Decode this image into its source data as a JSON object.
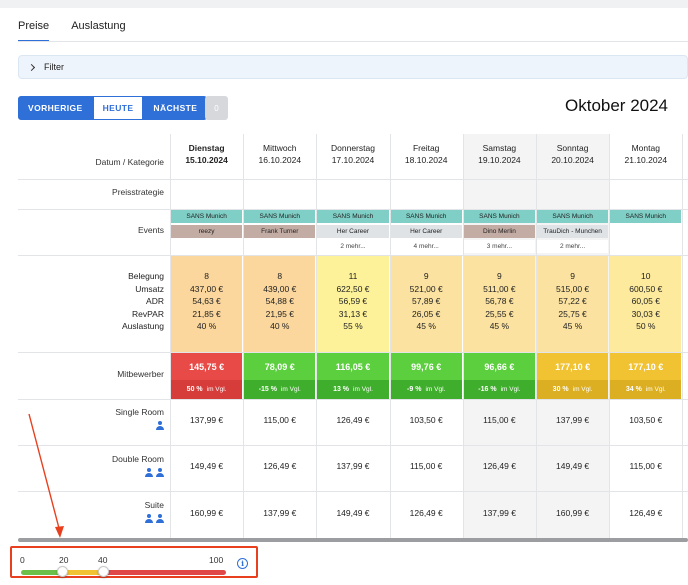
{
  "tabs": [
    {
      "label": "Preise",
      "active": true
    },
    {
      "label": "Auslastung",
      "active": false
    }
  ],
  "filter": {
    "label": "Filter"
  },
  "nav": {
    "prev": "VORHERIGE",
    "today": "HEUTE",
    "next": "NÄCHSTE",
    "count": "0"
  },
  "month_title": "Oktober 2024",
  "rows": {
    "date": "Datum / Kategorie",
    "strategy": "Preisstrategie",
    "events": "Events",
    "occupancy_labels": [
      "Belegung",
      "Umsatz",
      "ADR",
      "RevPAR",
      "Auslastung"
    ],
    "competitors": "Mitbewerber"
  },
  "days": [
    {
      "name": "Dienstag",
      "date": "15.10.2024",
      "bold": true,
      "shaded": false,
      "events": [
        {
          "text": "SANS Munich",
          "color": "teal"
        },
        {
          "text": "reezy",
          "color": "brown"
        },
        {
          "text": "",
          "color": "more"
        }
      ],
      "occ": [
        "8",
        "437,00 €",
        "54,63 €",
        "21,85 €",
        "40 %"
      ],
      "occ_color": "#fbd79e",
      "comp": {
        "price": "145,75 €",
        "pct": "50 %",
        "vgl": "im Vgl.",
        "top": "#e84a48",
        "bot": "#d63c3a"
      },
      "prices": [
        "137,99 €",
        "149,49 €",
        "160,99 €"
      ]
    },
    {
      "name": "Mittwoch",
      "date": "16.10.2024",
      "bold": false,
      "shaded": false,
      "events": [
        {
          "text": "SANS Munich",
          "color": "teal"
        },
        {
          "text": "Frank Turner",
          "color": "brown"
        },
        {
          "text": "",
          "color": "more"
        }
      ],
      "occ": [
        "8",
        "439,00 €",
        "54,88 €",
        "21,95 €",
        "40 %"
      ],
      "occ_color": "#fbd79e",
      "comp": {
        "price": "78,09 €",
        "pct": "-15 %",
        "vgl": "im Vgl.",
        "top": "#5ccf3e",
        "bot": "#3fae2c"
      },
      "prices": [
        "115,00 €",
        "126,49 €",
        "137,99 €"
      ]
    },
    {
      "name": "Donnerstag",
      "date": "17.10.2024",
      "bold": false,
      "shaded": false,
      "events": [
        {
          "text": "SANS Munich",
          "color": "teal"
        },
        {
          "text": "Her Career",
          "color": "gray"
        },
        {
          "text": "2 mehr...",
          "color": "more"
        }
      ],
      "occ": [
        "11",
        "622,50 €",
        "56,59 €",
        "31,13 €",
        "55 %"
      ],
      "occ_color": "#fdf29a",
      "comp": {
        "price": "116,05 €",
        "pct": "13 %",
        "vgl": "im Vgl.",
        "top": "#5ccf3e",
        "bot": "#3fae2c"
      },
      "prices": [
        "126,49 €",
        "137,99 €",
        "149,49 €"
      ]
    },
    {
      "name": "Freitag",
      "date": "18.10.2024",
      "bold": false,
      "shaded": false,
      "events": [
        {
          "text": "SANS Munich",
          "color": "teal"
        },
        {
          "text": "Her Career",
          "color": "gray"
        },
        {
          "text": "4 mehr...",
          "color": "more"
        }
      ],
      "occ": [
        "9",
        "521,00 €",
        "57,89 €",
        "26,05 €",
        "45 %"
      ],
      "occ_color": "#fbe2a0",
      "comp": {
        "price": "99,76 €",
        "pct": "-9 %",
        "vgl": "im Vgl.",
        "top": "#5ccf3e",
        "bot": "#3fae2c"
      },
      "prices": [
        "103,50 €",
        "115,00 €",
        "126,49 €"
      ]
    },
    {
      "name": "Samstag",
      "date": "19.10.2024",
      "bold": false,
      "shaded": true,
      "events": [
        {
          "text": "SANS Munich",
          "color": "teal"
        },
        {
          "text": "Dino Merlin",
          "color": "brown"
        },
        {
          "text": "3 mehr...",
          "color": "more"
        }
      ],
      "occ": [
        "9",
        "511,00 €",
        "56,78 €",
        "25,55 €",
        "45 %"
      ],
      "occ_color": "#fbe2a0",
      "comp": {
        "price": "96,66 €",
        "pct": "-16 %",
        "vgl": "im Vgl.",
        "top": "#5ccf3e",
        "bot": "#3fae2c"
      },
      "prices": [
        "115,00 €",
        "126,49 €",
        "137,99 €"
      ]
    },
    {
      "name": "Sonntag",
      "date": "20.10.2024",
      "bold": false,
      "shaded": true,
      "events": [
        {
          "text": "SANS Munich",
          "color": "teal"
        },
        {
          "text": "TrauDich - Munchen",
          "color": "gray"
        },
        {
          "text": "2 mehr...",
          "color": "more"
        }
      ],
      "occ": [
        "9",
        "515,00 €",
        "57,22 €",
        "25,75 €",
        "45 %"
      ],
      "occ_color": "#fbe2a0",
      "comp": {
        "price": "177,10 €",
        "pct": "30 %",
        "vgl": "im Vgl.",
        "top": "#f1c232",
        "bot": "#dcae22"
      },
      "prices": [
        "137,99 €",
        "149,49 €",
        "160,99 €"
      ]
    },
    {
      "name": "Montag",
      "date": "21.10.2024",
      "bold": false,
      "shaded": false,
      "events": [
        {
          "text": "SANS Munich",
          "color": "teal"
        },
        {
          "text": "",
          "color": "none"
        },
        {
          "text": "",
          "color": "none"
        }
      ],
      "occ": [
        "10",
        "600,50 €",
        "60,05 €",
        "30,03 €",
        "50 %"
      ],
      "occ_color": "#fdea9c",
      "comp": {
        "price": "177,10 €",
        "pct": "34 %",
        "vgl": "im Vgl.",
        "top": "#f1c232",
        "bot": "#dcae22"
      },
      "prices": [
        "103,50 €",
        "115,00 €",
        "126,49 €"
      ]
    }
  ],
  "room_types": [
    {
      "name": "Single Room",
      "persons": 1
    },
    {
      "name": "Double Room",
      "persons": 2
    },
    {
      "name": "Suite",
      "persons": 2
    }
  ],
  "legend": {
    "labels": [
      "0",
      "20",
      "40",
      "100"
    ],
    "thresholds": [
      0,
      20,
      40,
      100
    ],
    "colors": [
      "#6cc04a",
      "#f1c232",
      "#e04848"
    ],
    "knob_values": [
      20,
      40
    ]
  },
  "icons": {
    "info": "info-icon",
    "filter": "chevron-right-icon",
    "person": "person-icon",
    "annotation": "arrow-annotation"
  }
}
